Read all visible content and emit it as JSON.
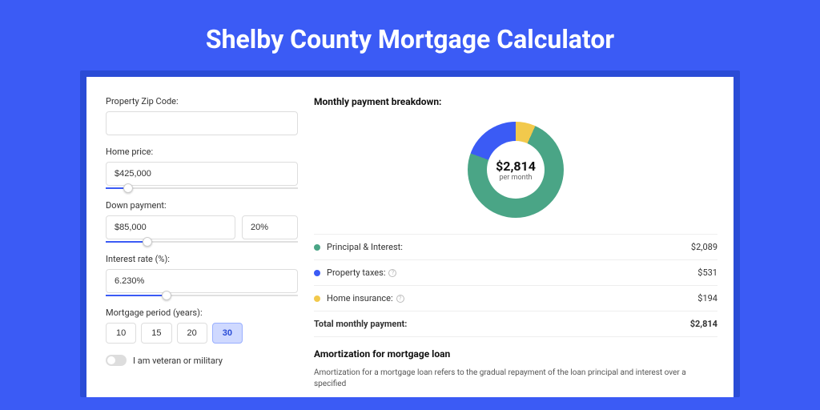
{
  "title": "Shelby County Mortgage Calculator",
  "form": {
    "zip_label": "Property Zip Code:",
    "zip_value": "",
    "price_label": "Home price:",
    "price_value": "$425,000",
    "down_label": "Down payment:",
    "down_value": "$85,000",
    "down_pct": "20%",
    "rate_label": "Interest rate (%):",
    "rate_value": "6.230%",
    "period_label": "Mortgage period (years):",
    "periods": [
      "10",
      "15",
      "20",
      "30"
    ],
    "period_selected": "30",
    "veteran_label": "I am veteran or military"
  },
  "breakdown": {
    "title": "Monthly payment breakdown:",
    "total_display": "$2,814",
    "per_month": "per month",
    "items": [
      {
        "label": "Principal & Interest:",
        "value": "$2,089",
        "color": "green"
      },
      {
        "label": "Property taxes:",
        "value": "$531",
        "color": "blue",
        "info": true
      },
      {
        "label": "Home insurance:",
        "value": "$194",
        "color": "yellow",
        "info": true
      }
    ],
    "total_label": "Total monthly payment:",
    "total_value": "$2,814"
  },
  "amort": {
    "title": "Amortization for mortgage loan",
    "text": "Amortization for a mortgage loan refers to the gradual repayment of the loan principal and interest over a specified"
  },
  "chart_data": {
    "type": "pie",
    "title": "Monthly payment breakdown",
    "series": [
      {
        "name": "Principal & Interest",
        "value": 2089,
        "color": "#4aa586"
      },
      {
        "name": "Property taxes",
        "value": 531,
        "color": "#3b5bf5"
      },
      {
        "name": "Home insurance",
        "value": 194,
        "color": "#f2c94c"
      }
    ],
    "total": 2814,
    "unit": "USD per month"
  }
}
